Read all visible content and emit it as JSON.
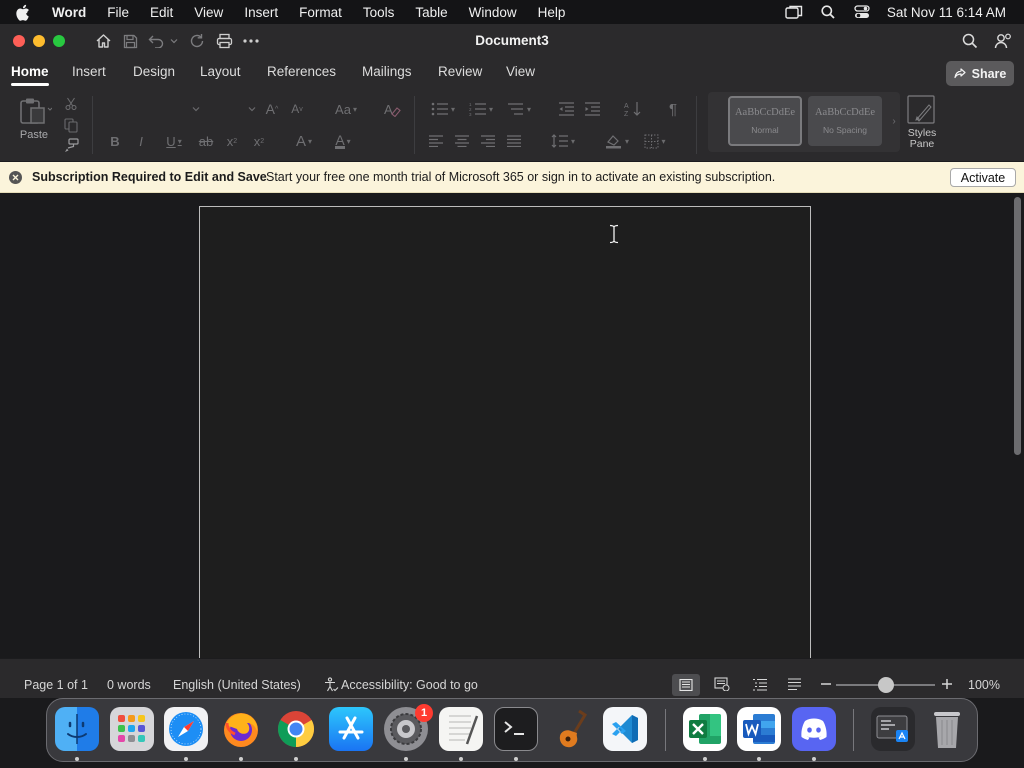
{
  "menubar": {
    "app_name": "Word",
    "items": [
      "File",
      "Edit",
      "View",
      "Insert",
      "Format",
      "Tools",
      "Table",
      "Window",
      "Help"
    ],
    "clock": "Sat Nov 11  6:14 AM"
  },
  "window": {
    "title": "Document3"
  },
  "ribbon_tabs": [
    "Home",
    "Insert",
    "Design",
    "Layout",
    "References",
    "Mailings",
    "Review",
    "View"
  ],
  "share_label": "Share",
  "ribbon": {
    "paste_label": "Paste",
    "styles": [
      {
        "sample": "AaBbCcDdEe",
        "name": "Normal"
      },
      {
        "sample": "AaBbCcDdEe",
        "name": "No Spacing"
      }
    ],
    "styles_pane_label": "Styles Pane"
  },
  "notification": {
    "title": "Subscription Required to Edit and Save",
    "message": "Start your free one month trial of Microsoft 365 or sign in to activate an existing subscription.",
    "button": "Activate"
  },
  "statusbar": {
    "page": "Page 1 of 1",
    "words": "0 words",
    "language": "English (United States)",
    "accessibility": "Accessibility: Good to go",
    "zoom": "100%"
  },
  "dock": {
    "badge_count": "1",
    "apps": [
      "Finder",
      "Launchpad",
      "Safari",
      "Firefox",
      "Chrome",
      "App Store",
      "System Settings",
      "TextEdit",
      "Terminal",
      "GarageBand",
      "Visual Studio Code",
      "Excel",
      "Word",
      "Discord",
      "Screenshot",
      "Trash"
    ]
  },
  "colors": {
    "accent": "#ffffff",
    "notification_bg": "#fbf4db",
    "window_bg": "#2b2a2c",
    "traffic_red": "#fe5f57",
    "traffic_yellow": "#febc2e",
    "traffic_green": "#28c840"
  }
}
